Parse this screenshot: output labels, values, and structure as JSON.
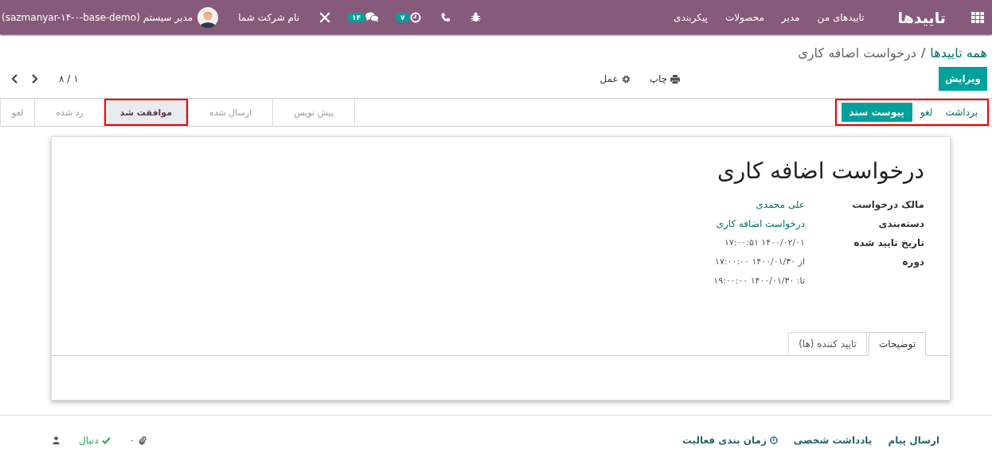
{
  "navbar": {
    "app_name": "تاییدها",
    "menu": [
      "تاییدهای من",
      "مدیر",
      "محصولات",
      "پیکربندی"
    ],
    "activity_badge": "۷",
    "messages_badge": "۱۴",
    "company": "نام شرکت شما",
    "user": "مدیر سیستم (sazmanyar-۱۴-۰-base-demo)"
  },
  "breadcrumb": {
    "parent": "همه تاییدها",
    "separator": "/",
    "current": "درخواست اضافه کاری"
  },
  "toolbar": {
    "edit": "ویرایش",
    "print": "چاپ",
    "action": "عمل",
    "pager": "۱ / ۸"
  },
  "header_buttons": {
    "highlighted": true,
    "items": [
      {
        "label": "برداشت",
        "kind": "link"
      },
      {
        "label": "لغو",
        "kind": "link"
      },
      {
        "label": "پیوست سند",
        "kind": "primary"
      }
    ]
  },
  "statusbar": [
    {
      "label": "پیش نویس",
      "selected": false,
      "highlighted": false
    },
    {
      "label": "ارسال شده",
      "selected": false,
      "highlighted": false
    },
    {
      "label": "موافقت شد",
      "selected": true,
      "highlighted": true
    },
    {
      "label": "رد شده",
      "selected": false,
      "highlighted": false
    },
    {
      "label": "لغو",
      "selected": false,
      "highlighted": false
    }
  ],
  "sheet": {
    "title": "درخواست اضافه کاری",
    "fields": [
      {
        "label": "مالک درخواست",
        "kind": "link",
        "values": [
          "علی محمدی"
        ]
      },
      {
        "label": "دسته‌بندی",
        "kind": "link",
        "values": [
          "درخواست اضافه کاری"
        ]
      },
      {
        "label": "تاریخ تایید شده",
        "kind": "text",
        "values": [
          "۱۴۰۰/۰۲/۰۱ ۱۷:۰۰:۵۱"
        ]
      },
      {
        "label": "دوره",
        "kind": "text",
        "values": [
          "از ۱۴۰۰/۰۱/۳۰ ۱۷:۰۰:۰۰",
          "تا: ۱۴۰۰/۰۱/۳۰ ۱۹:۰۰:۰۰"
        ]
      }
    ],
    "tabs": [
      {
        "label": "توضیحات",
        "selected": true
      },
      {
        "label": "تایید کننده (ها)",
        "selected": false
      }
    ]
  },
  "chatter": {
    "send_message": "ارسال پیام",
    "log_note": "یادداشت شخصی",
    "schedule": "زمان بندی فعالیت",
    "attachments": "۰",
    "follow": "دنبال"
  }
}
